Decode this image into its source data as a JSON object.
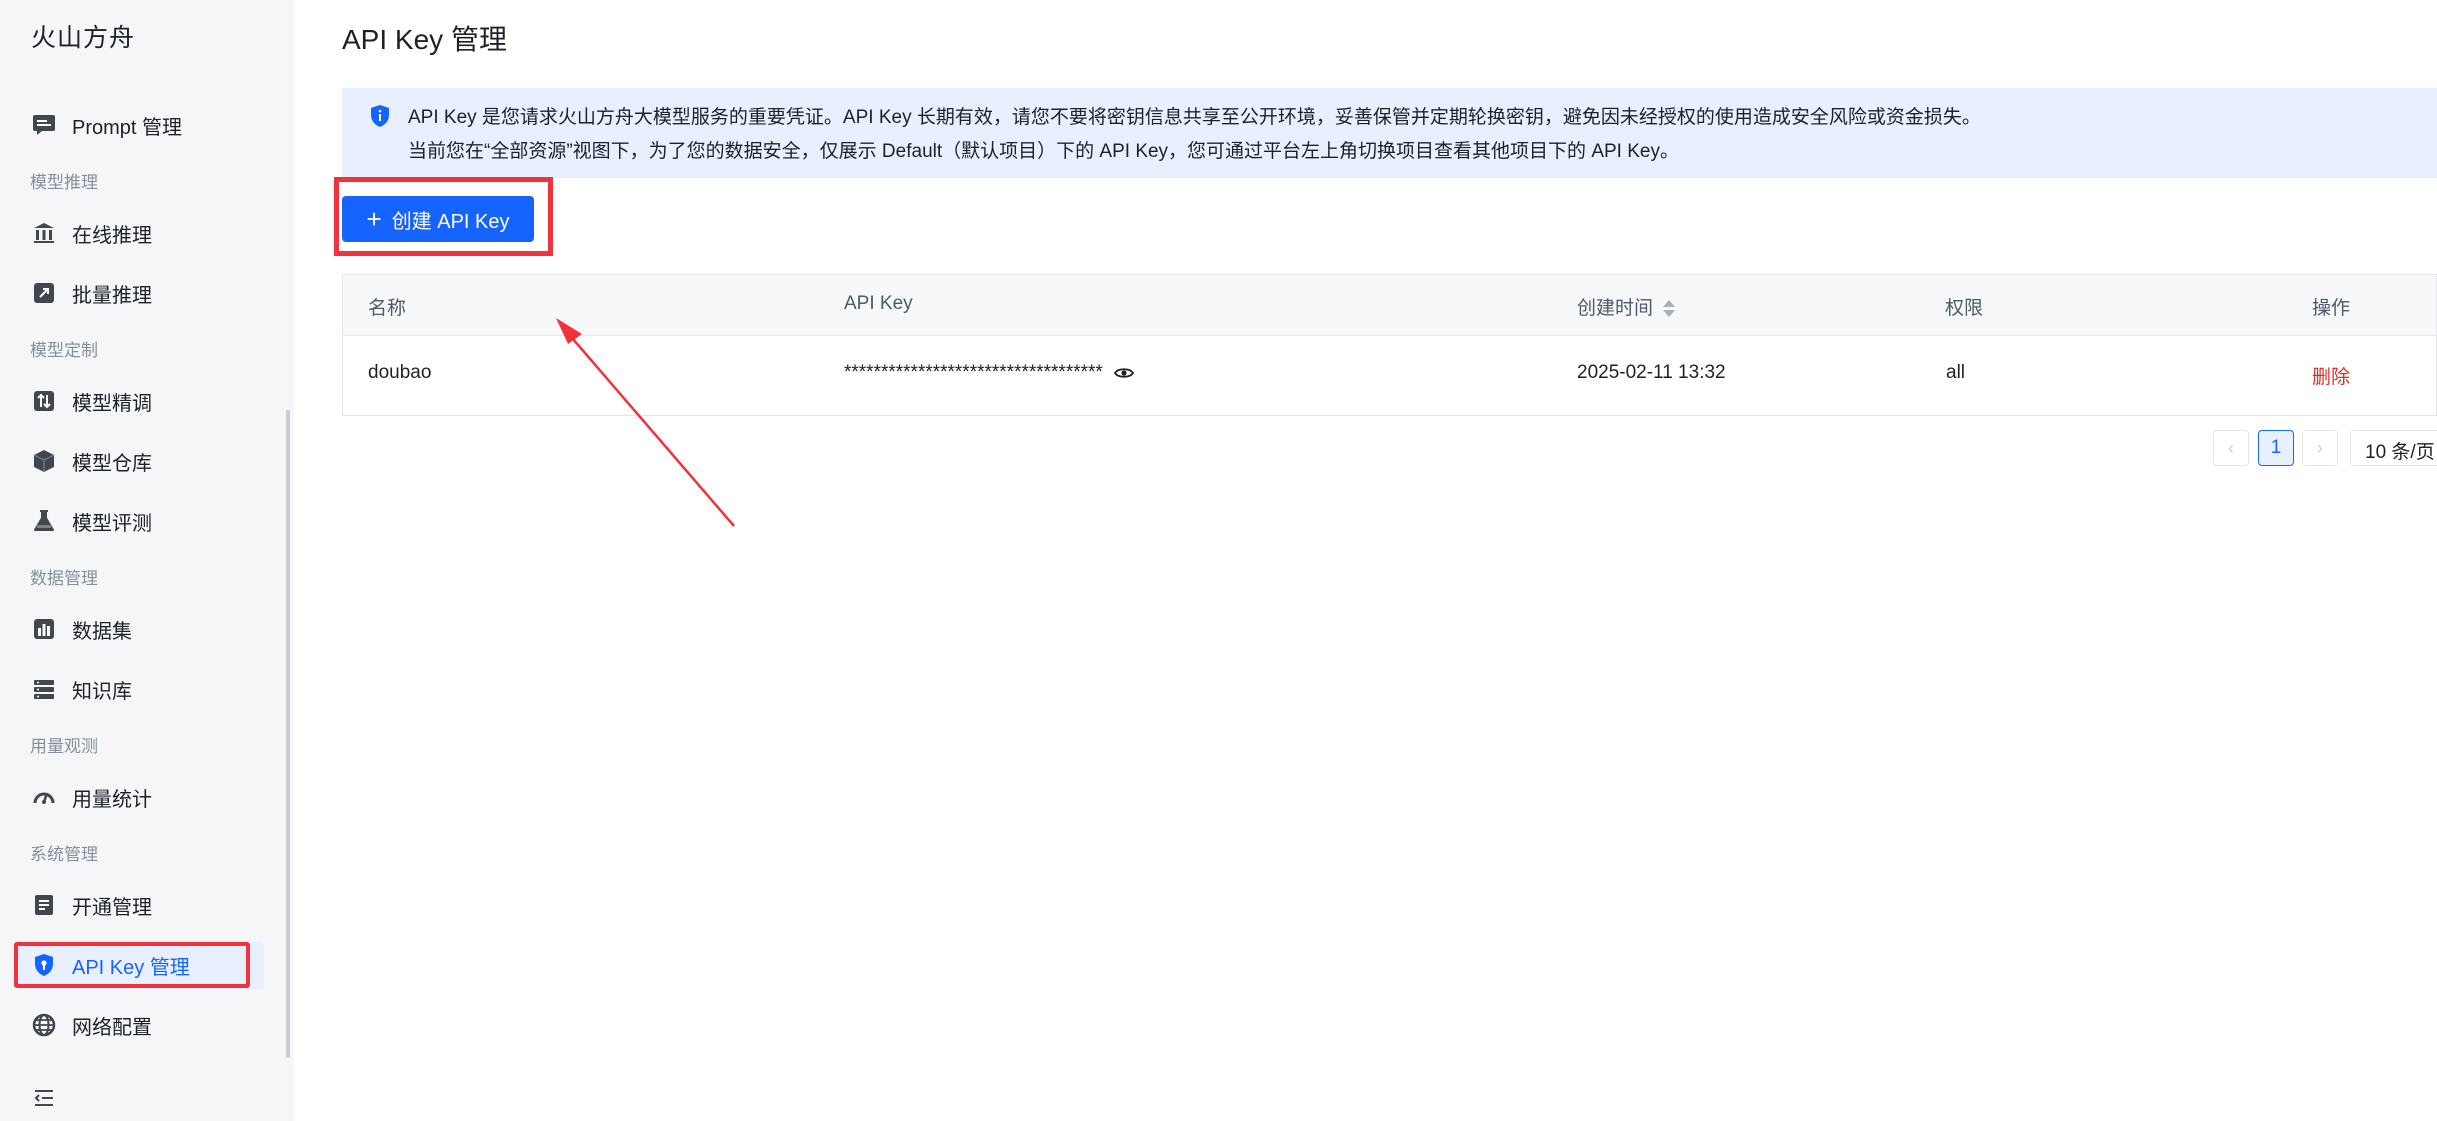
{
  "sidebar": {
    "brand": "火山方舟",
    "items": [
      {
        "label": "Prompt 管理"
      },
      {
        "label": "在线推理"
      },
      {
        "label": "批量推理"
      },
      {
        "label": "模型精调"
      },
      {
        "label": "模型仓库"
      },
      {
        "label": "模型评测"
      },
      {
        "label": "数据集"
      },
      {
        "label": "知识库"
      },
      {
        "label": "用量统计"
      },
      {
        "label": "开通管理"
      },
      {
        "label": "API Key 管理"
      },
      {
        "label": "网络配置"
      }
    ],
    "groups": [
      "模型推理",
      "模型定制",
      "数据管理",
      "用量观测",
      "系统管理"
    ],
    "active_item": "API Key 管理"
  },
  "page": {
    "title": "API Key 管理",
    "notice_line1": "API Key 是您请求火山方舟大模型服务的重要凭证。API Key 长期有效，请您不要将密钥信息共享至公开环境，妥善保管并定期轮换密钥，避免因未经授权的使用造成安全风险或资金损失。",
    "notice_line2": "当前您在“全部资源”视图下，为了您的数据安全，仅展示 Default（默认项目）下的 API Key，您可通过平台左上角切换项目查看其他项目下的 API Key。",
    "create_button": "创建 API Key"
  },
  "table": {
    "columns": [
      "名称",
      "API Key",
      "创建时间",
      "权限",
      "操作"
    ],
    "rows": [
      {
        "name": "doubao",
        "api_key": "***********************************",
        "created": "2025-02-11 13:32",
        "permission": "all",
        "action": "删除"
      }
    ]
  },
  "pagination": {
    "current_page": "1",
    "page_size": "10 条/页"
  },
  "colors": {
    "primary": "#1664ff",
    "highlight": "#f0323c",
    "danger": "#d7312a"
  }
}
